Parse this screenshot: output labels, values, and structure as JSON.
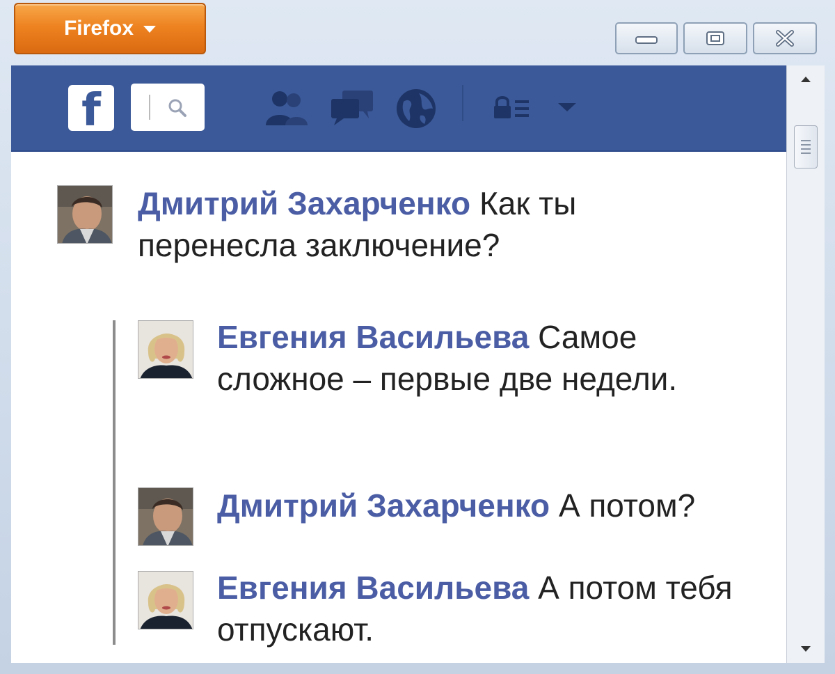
{
  "titlebar": {
    "app_menu_label": "Firefox",
    "controls": [
      "minimize",
      "maximize",
      "close"
    ]
  },
  "facebook": {
    "logo_letter": "f",
    "nav_icons": [
      "friends-icon",
      "messages-icon",
      "globe-icon",
      "privacy-lock-icon",
      "account-menu-chevron-icon"
    ]
  },
  "thread": {
    "top_comment": {
      "author": "Дмитрий Захарченко",
      "text": "Как ты перенесла заключение?"
    },
    "replies": [
      {
        "author": "Евгения Васильева",
        "text": "Самое сложное – первые две недели."
      },
      {
        "author": "Дмитрий Захарченко",
        "text": "А потом?"
      },
      {
        "author": "Евгения Васильева",
        "text": "А потом тебя отпускают."
      }
    ]
  },
  "colors": {
    "firefox_orange": "#ee8321",
    "facebook_blue": "#3b5998",
    "author_link": "#4b5ea5"
  }
}
